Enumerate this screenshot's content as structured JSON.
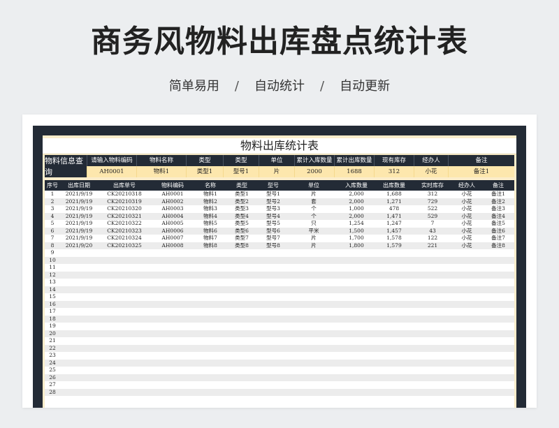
{
  "header": {
    "title": "商务风物料出库盘点统计表",
    "subtitle_parts": [
      "简单易用",
      "自动统计",
      "自动更新"
    ],
    "separator": "/"
  },
  "sheet": {
    "title": "物料出库统计表",
    "inquiry": {
      "label": "物料信息查询",
      "headers": [
        "请输入物料编码",
        "物料名称",
        "类型",
        "类型",
        "单位",
        "累计入库数量",
        "累计出库数量",
        "现有库存",
        "经办人",
        "备注"
      ],
      "values": [
        "AH0001",
        "物料1",
        "类型1",
        "型号1",
        "片",
        "2000",
        "1688",
        "312",
        "小花",
        "备注1"
      ]
    },
    "table": {
      "columns": [
        "序号",
        "出库日期",
        "出库单号",
        "物料编码",
        "名称",
        "类型",
        "型号",
        "单位",
        "入库数量",
        "出库数量",
        "实时库存",
        "经办人",
        "备注"
      ],
      "rows": [
        [
          "1",
          "2021/9/19",
          "CK20210318",
          "AH0001",
          "物料1",
          "类型1",
          "型号1",
          "片",
          "2,000",
          "1,688",
          "312",
          "小花",
          "备注1"
        ],
        [
          "2",
          "2021/9/19",
          "CK20210319",
          "AH0002",
          "物料2",
          "类型2",
          "型号2",
          "套",
          "2,000",
          "1,271",
          "729",
          "小花",
          "备注2"
        ],
        [
          "3",
          "2021/9/19",
          "CK20210320",
          "AH0003",
          "物料3",
          "类型3",
          "型号3",
          "个",
          "1,000",
          "478",
          "522",
          "小花",
          "备注3"
        ],
        [
          "4",
          "2021/9/19",
          "CK20210321",
          "AH0004",
          "物料4",
          "类型4",
          "型号4",
          "个",
          "2,000",
          "1,471",
          "529",
          "小花",
          "备注4"
        ],
        [
          "5",
          "2021/9/19",
          "CK20210322",
          "AH0005",
          "物料5",
          "类型5",
          "型号5",
          "只",
          "1,254",
          "1,247",
          "7",
          "小花",
          "备注5"
        ],
        [
          "6",
          "2021/9/19",
          "CK20210323",
          "AH0006",
          "物料6",
          "类型6",
          "型号6",
          "平米",
          "1,500",
          "1,457",
          "43",
          "小花",
          "备注6"
        ],
        [
          "7",
          "2021/9/19",
          "CK20210324",
          "AH0007",
          "物料7",
          "类型7",
          "型号7",
          "片",
          "1,700",
          "1,578",
          "122",
          "小花",
          "备注7"
        ],
        [
          "8",
          "2021/9/20",
          "CK20210325",
          "AH0008",
          "物料8",
          "类型8",
          "型号8",
          "片",
          "1,800",
          "1,579",
          "221",
          "小花",
          "备注8"
        ],
        [
          "9"
        ],
        [
          "10"
        ],
        [
          "11"
        ],
        [
          "12"
        ],
        [
          "13"
        ],
        [
          "14"
        ],
        [
          "15"
        ],
        [
          "16"
        ],
        [
          "17"
        ],
        [
          "18"
        ],
        [
          "19"
        ],
        [
          "20"
        ],
        [
          "21"
        ],
        [
          "22"
        ],
        [
          "23"
        ],
        [
          "24"
        ],
        [
          "25"
        ],
        [
          "26"
        ],
        [
          "27"
        ],
        [
          "28"
        ]
      ]
    }
  }
}
